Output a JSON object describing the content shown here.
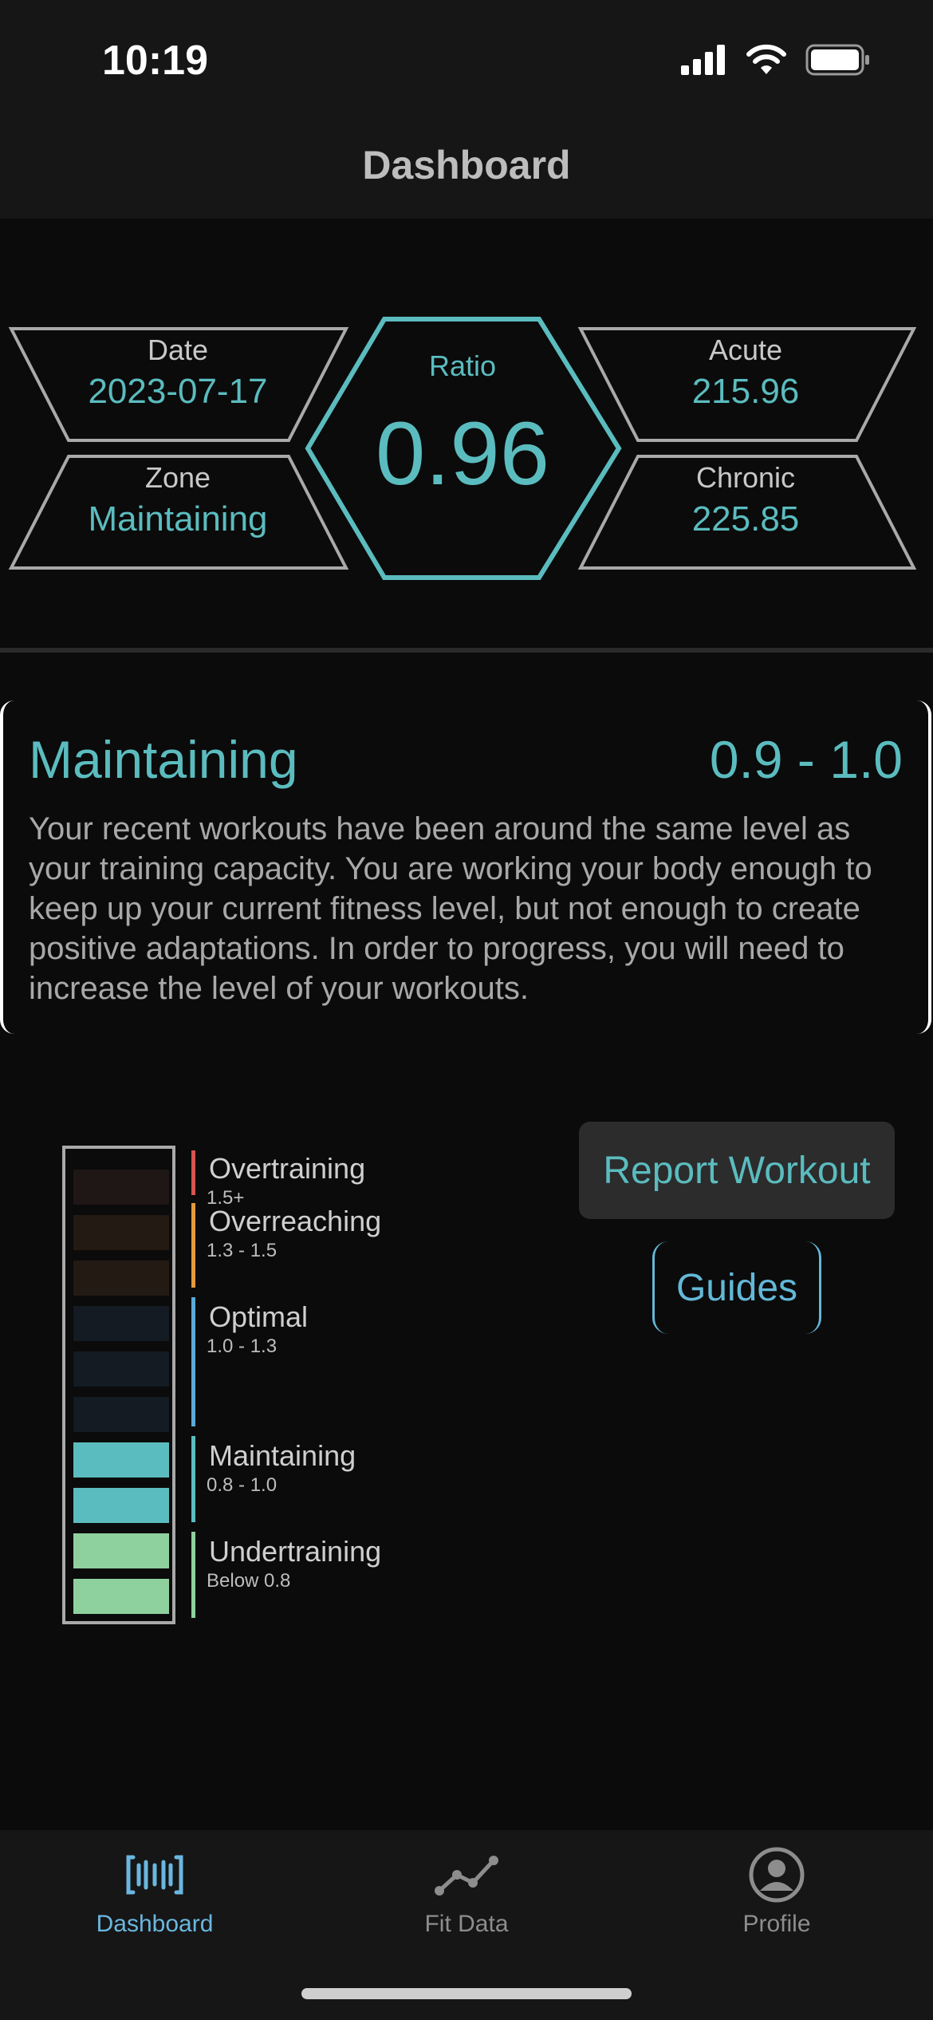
{
  "status_bar": {
    "time": "10:19"
  },
  "nav": {
    "title": "Dashboard"
  },
  "stats": {
    "date": {
      "label": "Date",
      "value": "2023-07-17"
    },
    "zone": {
      "label": "Zone",
      "value": "Maintaining"
    },
    "ratio": {
      "label": "Ratio",
      "value": "0.96"
    },
    "acute": {
      "label": "Acute",
      "value": "215.96"
    },
    "chronic": {
      "label": "Chronic",
      "value": "225.85"
    }
  },
  "zone_card": {
    "name": "Maintaining",
    "range": "0.9 - 1.0",
    "description": "Your recent workouts have been around the same level as your training capacity. You are working your body enough to keep up your current fitness level, but not enough to create positive adaptations. In order to progress, you will need to increase the level of your workouts."
  },
  "legend": [
    {
      "name": "Overtraining",
      "range": "1.5+",
      "color": "#d9534f"
    },
    {
      "name": "Overreaching",
      "range": "1.3 - 1.5",
      "color": "#e39a3c"
    },
    {
      "name": "Optimal",
      "range": "1.0 - 1.3",
      "color": "#5aa9d6"
    },
    {
      "name": "Maintaining",
      "range": "0.8 - 1.0",
      "color": "#5bbcbf"
    },
    {
      "name": "Undertraining",
      "range": "Below 0.8",
      "color": "#8fd19e"
    }
  ],
  "meter": {
    "segments_lit": 4,
    "segment_colors": [
      "#1f1616",
      "#231a14",
      "#231a14",
      "#141b22",
      "#141b22",
      "#141b22",
      "#5bbcbf",
      "#5bbcbf",
      "#8fd19e",
      "#8fd19e"
    ]
  },
  "buttons": {
    "report": "Report Workout",
    "guides": "Guides"
  },
  "tabs": [
    {
      "label": "Dashboard",
      "icon": "waveform-icon",
      "active": true
    },
    {
      "label": "Fit Data",
      "icon": "line-chart-icon",
      "active": false
    },
    {
      "label": "Profile",
      "icon": "profile-icon",
      "active": false
    }
  ],
  "colors": {
    "accent": "#5bbcbf",
    "link": "#63b8d8",
    "tab_active": "#6ab7e0",
    "tab_inactive": "#8d8d8d"
  }
}
